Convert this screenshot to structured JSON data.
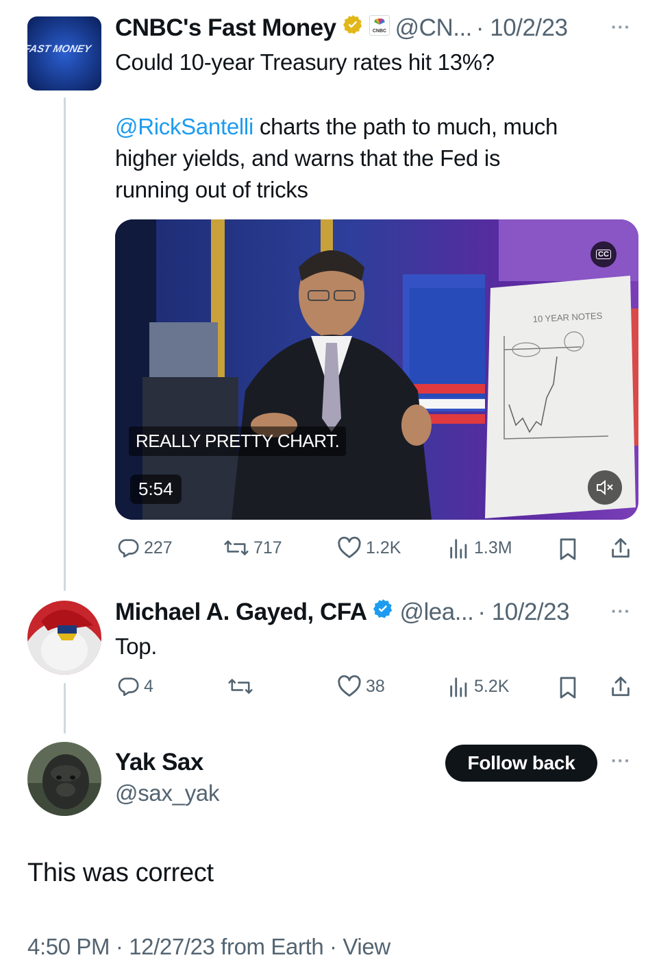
{
  "tweet1": {
    "avatar_text": "FAST MONEY",
    "name": "CNBC's Fast Money",
    "verified_badge": "gold-check",
    "affiliate_label": "CNBC",
    "handle": "@CN...",
    "date": "· 10/2/23",
    "more": "···",
    "text_line1": "Could 10-year Treasury rates hit 13%?",
    "mention": "@RickSantelli",
    "text_line2_rest": " charts the path to much, much",
    "text_line3": "higher yields, and warns that the Fed is",
    "text_line4": "running out of tricks",
    "video": {
      "caption": "REALLY PRETTY CHART.",
      "duration": "5:54",
      "cc": "CC",
      "whiteboard_title": "10 YEAR NOTES"
    },
    "stats": {
      "replies": "227",
      "reposts": "717",
      "likes": "1.2K",
      "views": "1.3M"
    }
  },
  "tweet2": {
    "name": "Michael A. Gayed, CFA",
    "verified_badge": "blue-check",
    "handle": "@lea...",
    "date": "· 10/2/23",
    "more": "···",
    "text": "Top.",
    "stats": {
      "replies": "4",
      "reposts": "",
      "likes": "38",
      "views": "5.2K"
    }
  },
  "tweet3": {
    "name": "Yak Sax",
    "handle": "@sax_yak",
    "follow_label": "Follow back",
    "more": "···",
    "text": "This was correct",
    "footer": "4:50 PM · 12/27/23 from Earth · View"
  },
  "colors": {
    "accent": "#1d9bf0",
    "gold": "#e2b719",
    "muted": "#536471"
  }
}
